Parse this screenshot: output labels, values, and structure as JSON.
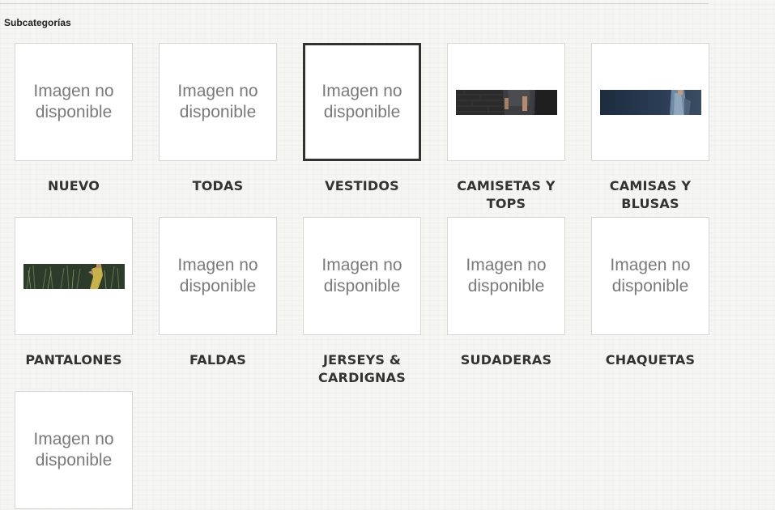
{
  "section": {
    "title": "Subcategorías"
  },
  "placeholder_text": "Imagen no disponible",
  "categories": [
    {
      "label": "NUEVO",
      "image": "placeholder"
    },
    {
      "label": "TODAS",
      "image": "placeholder"
    },
    {
      "label": "VESTIDOS",
      "image": "placeholder",
      "selected": true
    },
    {
      "label": "CAMISETAS Y TOPS",
      "image": "photo-dark-brick-wall-model"
    },
    {
      "label": "CAMISAS Y BLUSAS",
      "image": "photo-navy-model-denim"
    },
    {
      "label": "PANTALONES",
      "image": "photo-model-in-grass-field"
    },
    {
      "label": "FALDAS",
      "image": "placeholder"
    },
    {
      "label": "JERSEYS & CARDIGNAS",
      "image": "placeholder"
    },
    {
      "label": "SUDADERAS",
      "image": "placeholder"
    },
    {
      "label": "CHAQUETAS",
      "image": "placeholder"
    },
    {
      "label": "",
      "image": "placeholder"
    }
  ],
  "colors": {
    "background": "#f5f5f4",
    "tile_border": "#d6d6d6",
    "selected_border": "#333333",
    "label": "#333333",
    "placeholder_text": "#7a7a7a"
  }
}
